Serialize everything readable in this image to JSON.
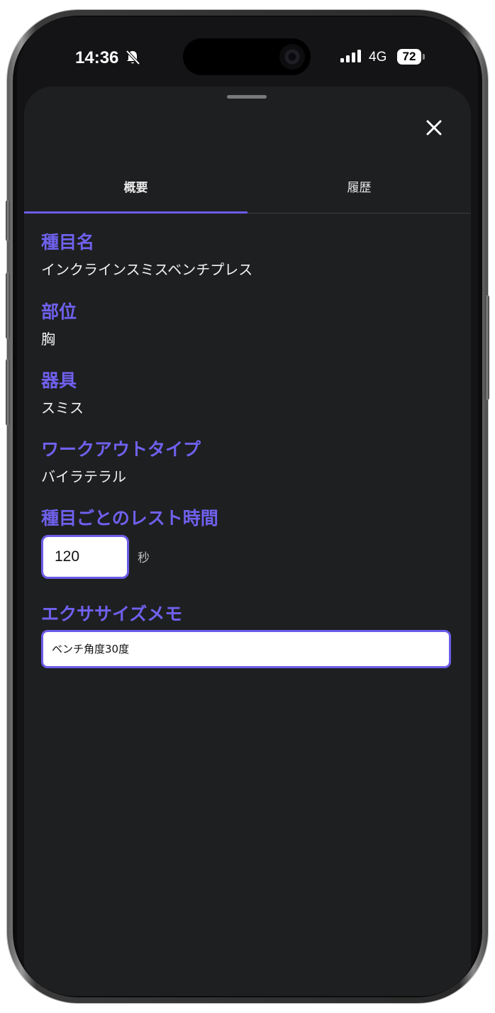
{
  "status_bar": {
    "time": "14:36",
    "network": "4G",
    "battery": "72"
  },
  "tabs": [
    {
      "label": "概要",
      "active": true
    },
    {
      "label": "履歴",
      "active": false
    }
  ],
  "fields": {
    "exercise_name_label": "種目名",
    "exercise_name_value": "インクラインスミスベンチプレス",
    "body_part_label": "部位",
    "body_part_value": "胸",
    "equipment_label": "器具",
    "equipment_value": "スミス",
    "workout_type_label": "ワークアウトタイプ",
    "workout_type_value": "バイラテラル",
    "rest_time_label": "種目ごとのレスト時間",
    "rest_time_value": "120",
    "rest_time_unit": "秒",
    "memo_label": "エクササイズメモ",
    "memo_value": "ベンチ角度30度"
  },
  "colors": {
    "accent": "#6b5ce7",
    "sheet_bg": "#1e1f21",
    "label": "#6f61ee"
  },
  "icons": {
    "close": "close-icon",
    "silent": "bell-slash-icon",
    "signal": "cellular-signal-icon"
  }
}
